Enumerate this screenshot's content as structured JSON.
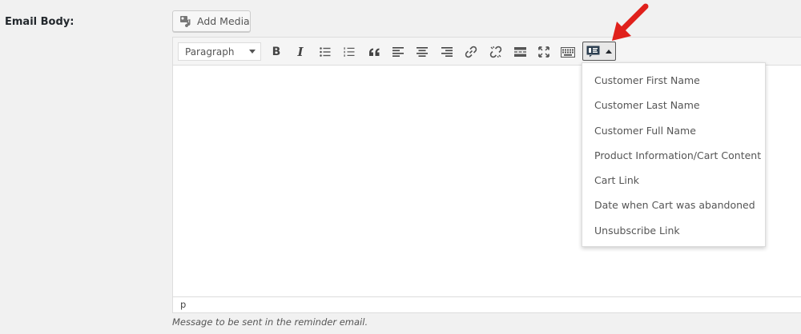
{
  "field": {
    "label": "Email Body:"
  },
  "media": {
    "add_media_label": "Add Media"
  },
  "toolbar": {
    "format_select": "Paragraph",
    "bold_label": "B",
    "italic_label": "I",
    "buttons": [
      "bold",
      "italic",
      "bulleted-list",
      "numbered-list",
      "blockquote",
      "align-left",
      "align-center",
      "align-right",
      "insert-link",
      "remove-link",
      "read-more",
      "fullscreen",
      "toolbar-toggle",
      "placeholder-insert"
    ]
  },
  "placeholder_menu": {
    "items": [
      "Customer First Name",
      "Customer Last Name",
      "Customer Full Name",
      "Product Information/Cart Content",
      "Cart Link",
      "Date when Cart was abandoned",
      "Unsubscribe Link"
    ]
  },
  "status_bar": {
    "path": "p"
  },
  "help_text": "Message to be sent in the reminder email.",
  "colors": {
    "arrow": "#e0201b",
    "toolbar_bg": "#f5f5f5",
    "page_bg": "#f1f1f1"
  }
}
